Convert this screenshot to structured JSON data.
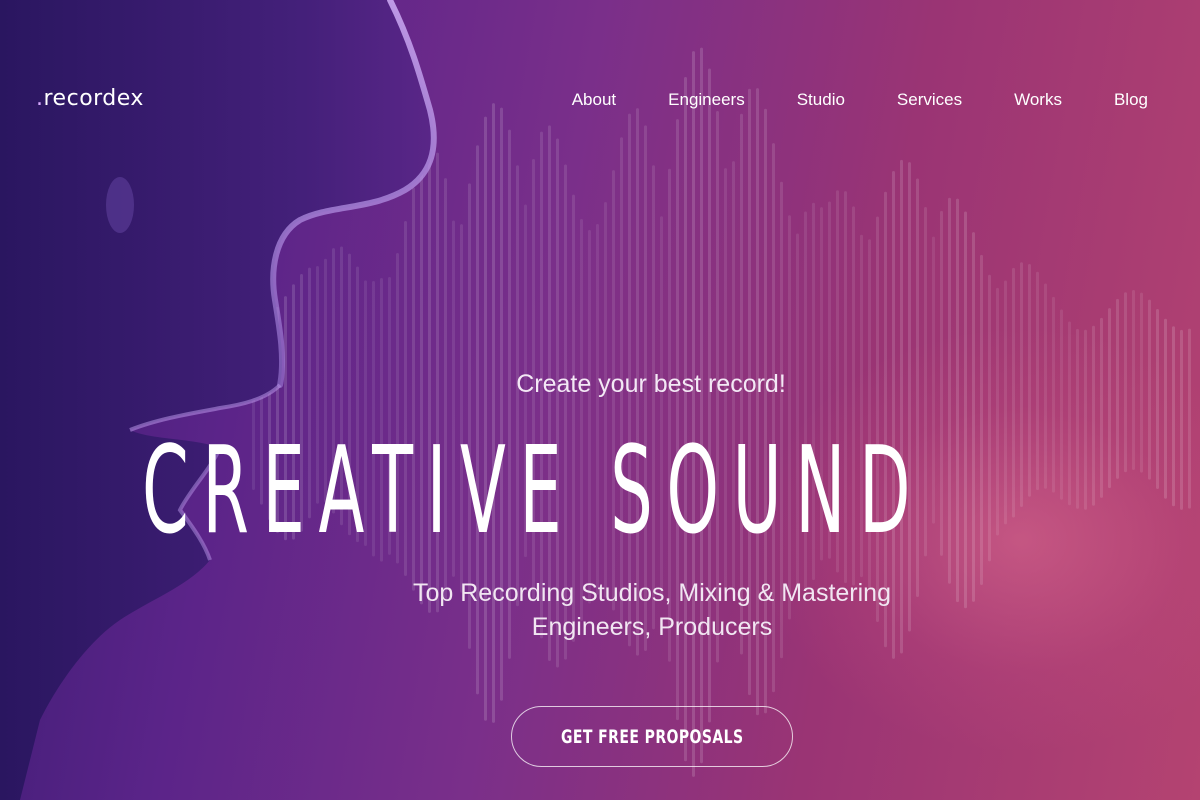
{
  "header": {
    "brand_dot": ".",
    "brand_name": "recordex",
    "nav": [
      {
        "label": "About"
      },
      {
        "label": "Engineers"
      },
      {
        "label": "Studio"
      },
      {
        "label": "Services"
      },
      {
        "label": "Works"
      },
      {
        "label": "Blog"
      }
    ]
  },
  "hero": {
    "tagline": "Create your best record!",
    "headline": "CREATIVE SOUND",
    "subtitle_line1": "Top Recording Studios, Mixing & Mastering",
    "subtitle_line2": "Engineers, Producers",
    "cta_label": "GET FREE PROPOSALS"
  },
  "colors": {
    "gradient_left": "#3a1c72",
    "gradient_right": "#b44371",
    "accent_dot": "#d7a8ff",
    "text": "#ffffff"
  },
  "images": {
    "background": "singer-face-silhouette-with-sound-wave"
  }
}
